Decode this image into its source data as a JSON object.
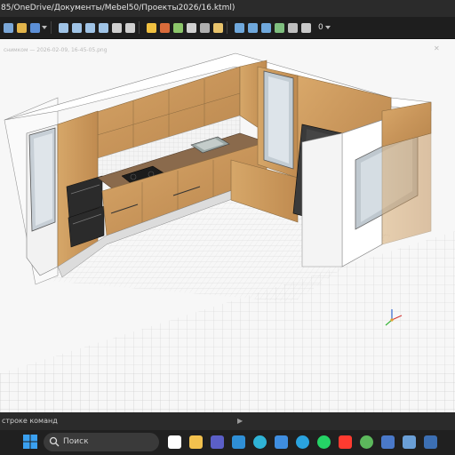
{
  "window": {
    "title": "85/OneDrive/Документы/Mebel50/Проекты2026/16.ktml)"
  },
  "toolbar": {
    "buttons": [
      {
        "icon": "new-file-icon",
        "color": "#7aa7d8"
      },
      {
        "icon": "open-folder-icon",
        "color": "#e2b44a"
      },
      {
        "icon": "save-icon",
        "color": "#5c8fd6"
      },
      {
        "icon": "dropdown-icon",
        "color": "#bbbbbb"
      },
      {
        "icon": "zoom-in-icon",
        "color": "#9fc3e6"
      },
      {
        "icon": "zoom-out-icon",
        "color": "#9fc3e6"
      },
      {
        "icon": "zoom-window-icon",
        "color": "#9fc3e6"
      },
      {
        "icon": "zoom-extents-icon",
        "color": "#9fc3e6"
      },
      {
        "icon": "pan-icon",
        "color": "#cfcfcf"
      },
      {
        "icon": "orbit-icon",
        "color": "#cfcfcf"
      },
      {
        "icon": "render-icon",
        "color": "#f0c040"
      },
      {
        "icon": "materials-icon",
        "color": "#d96b3a"
      },
      {
        "icon": "layers-icon",
        "color": "#8cc66a"
      },
      {
        "icon": "measure-icon",
        "color": "#d0d0d0"
      },
      {
        "icon": "print-icon",
        "color": "#b0b0b0"
      },
      {
        "icon": "properties-icon",
        "color": "#e8c36b"
      },
      {
        "icon": "view-front-icon",
        "color": "#6fa8dc"
      },
      {
        "icon": "view-top-icon",
        "color": "#6fa8dc"
      },
      {
        "icon": "view-iso-icon",
        "color": "#6fa8dc"
      },
      {
        "icon": "shade-icon",
        "color": "#7fbf7f"
      },
      {
        "icon": "wireframe-icon",
        "color": "#bfbfbf"
      },
      {
        "icon": "camera-icon",
        "color": "#c9c9c9"
      }
    ],
    "zoom_value": "0"
  },
  "viewport": {
    "filename": "снимком — 2026-02-09, 16-45-05.png",
    "close_label": "✕"
  },
  "command_line": {
    "label": "строке команд"
  },
  "taskbar": {
    "search_placeholder": "Поиск",
    "apps": [
      {
        "icon": "task-view-icon",
        "color": "#ffffff"
      },
      {
        "icon": "file-explorer-icon",
        "color": "#f2c14e"
      },
      {
        "icon": "teams-icon",
        "color": "#5b5fc7"
      },
      {
        "icon": "gallery-icon",
        "color": "#2f8fd6"
      },
      {
        "icon": "edge-icon",
        "color": "#2fb3d6"
      },
      {
        "icon": "microsoft-store-icon",
        "color": "#3f8ee0"
      },
      {
        "icon": "telegram-icon",
        "color": "#2aa3df"
      },
      {
        "icon": "whatsapp-icon",
        "color": "#25d366"
      },
      {
        "icon": "yandex-browser-icon",
        "color": "#ff3b30"
      },
      {
        "icon": "utorrent-icon",
        "color": "#5cb85c"
      },
      {
        "icon": "app-window-icon",
        "color": "#4a79c9"
      },
      {
        "icon": "app-window-2-icon",
        "color": "#6a9fd6"
      },
      {
        "icon": "app-window-3-icon",
        "color": "#3c6fb3"
      }
    ]
  }
}
